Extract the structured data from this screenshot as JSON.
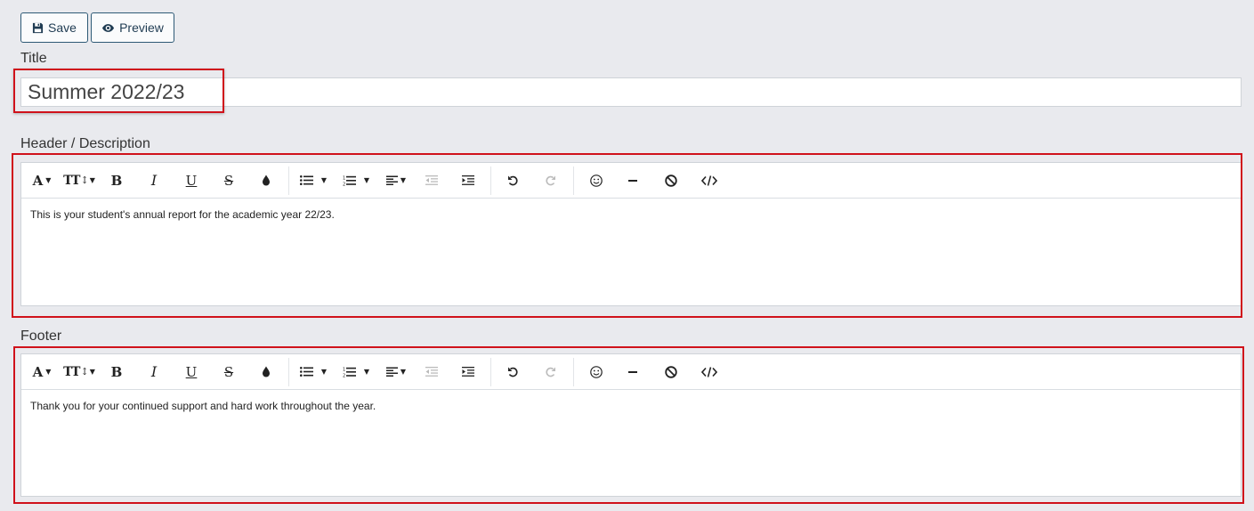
{
  "toolbar": {
    "save_label": "Save",
    "preview_label": "Preview"
  },
  "title": {
    "label": "Title",
    "value": "Summer 2022/23"
  },
  "header": {
    "label": "Header / Description",
    "content": "This is your student's annual report for the academic year 22/23."
  },
  "footer": {
    "label": "Footer",
    "content": "Thank you for your continued support and hard work throughout the year."
  },
  "editor_toolbar": {
    "font": "A",
    "font_size": "TT",
    "bold": "B",
    "italic": "I",
    "underline": "U",
    "strikethrough": "S"
  },
  "highlight_color": "#d0121b",
  "icons": [
    "save-icon",
    "eye-icon",
    "font-icon",
    "font-size-icon",
    "bold-icon",
    "italic-icon",
    "underline-icon",
    "strikethrough-icon",
    "color-drop-icon",
    "bullet-list-icon",
    "numbered-list-icon",
    "align-icon",
    "outdent-icon",
    "indent-icon",
    "undo-icon",
    "redo-icon",
    "emoji-icon",
    "horizontal-rule-icon",
    "clear-format-icon",
    "code-view-icon"
  ]
}
